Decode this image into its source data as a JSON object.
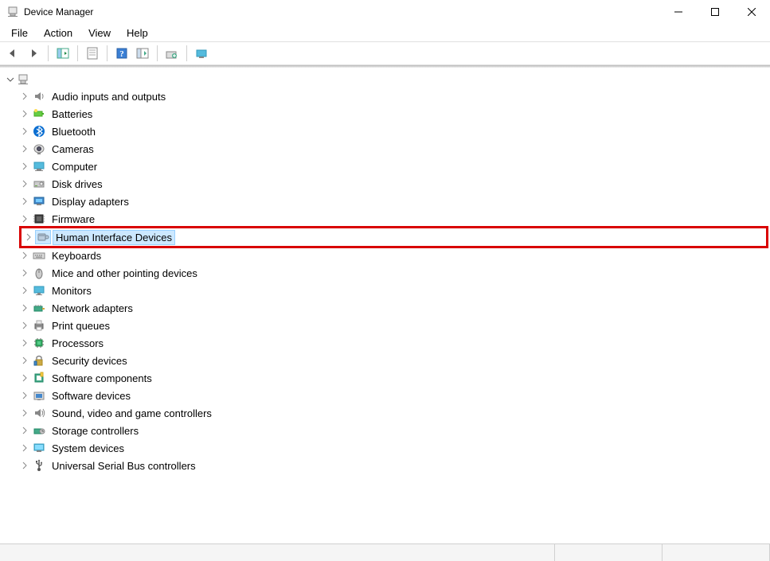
{
  "window": {
    "title": "Device Manager"
  },
  "menu": {
    "items": [
      {
        "label": "File"
      },
      {
        "label": "Action"
      },
      {
        "label": "View"
      },
      {
        "label": "Help"
      }
    ]
  },
  "tree": {
    "root_icon": "computer-root-icon",
    "items": [
      {
        "label": "Audio inputs and outputs",
        "icon": "speaker-icon"
      },
      {
        "label": "Batteries",
        "icon": "battery-icon"
      },
      {
        "label": "Bluetooth",
        "icon": "bluetooth-icon"
      },
      {
        "label": "Cameras",
        "icon": "camera-icon"
      },
      {
        "label": "Computer",
        "icon": "computer-icon"
      },
      {
        "label": "Disk drives",
        "icon": "disk-icon"
      },
      {
        "label": "Display adapters",
        "icon": "display-adapter-icon"
      },
      {
        "label": "Firmware",
        "icon": "firmware-icon"
      },
      {
        "label": "Human Interface Devices",
        "icon": "hid-icon",
        "selected": true,
        "highlighted": true
      },
      {
        "label": "Keyboards",
        "icon": "keyboard-icon"
      },
      {
        "label": "Mice and other pointing devices",
        "icon": "mouse-icon"
      },
      {
        "label": "Monitors",
        "icon": "monitor-icon"
      },
      {
        "label": "Network adapters",
        "icon": "network-icon"
      },
      {
        "label": "Print queues",
        "icon": "printer-icon"
      },
      {
        "label": "Processors",
        "icon": "processor-icon"
      },
      {
        "label": "Security devices",
        "icon": "security-icon"
      },
      {
        "label": "Software components",
        "icon": "software-component-icon"
      },
      {
        "label": "Software devices",
        "icon": "software-device-icon"
      },
      {
        "label": "Sound, video and game controllers",
        "icon": "sound-icon"
      },
      {
        "label": "Storage controllers",
        "icon": "storage-icon"
      },
      {
        "label": "System devices",
        "icon": "system-icon"
      },
      {
        "label": "Universal Serial Bus controllers",
        "icon": "usb-icon"
      }
    ]
  }
}
